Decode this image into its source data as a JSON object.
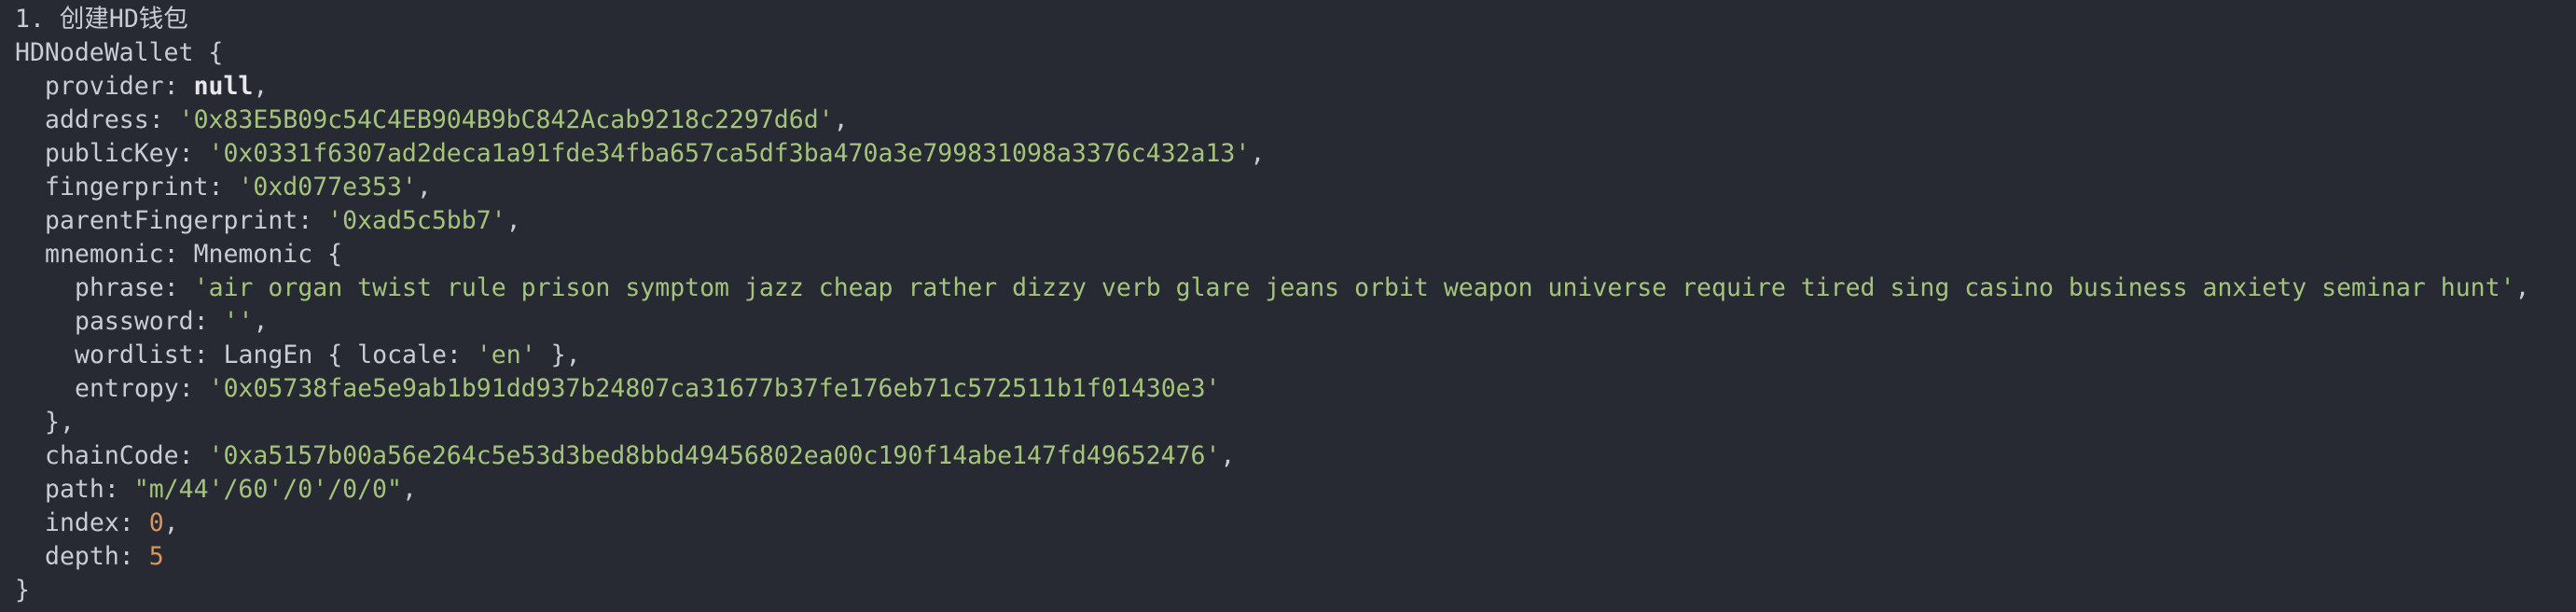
{
  "heading": "1. 创建HD钱包",
  "root_class": "HDNodeWallet",
  "fields": {
    "provider": {
      "key": "provider",
      "value": "null"
    },
    "address": {
      "key": "address",
      "value": "'0x83E5B09c54C4EB904B9bC842Acab9218c2297d6d'"
    },
    "publicKey": {
      "key": "publicKey",
      "value": "'0x0331f6307ad2deca1a91fde34fba657ca5df3ba470a3e799831098a3376c432a13'"
    },
    "fingerprint": {
      "key": "fingerprint",
      "value": "'0xd077e353'"
    },
    "parentFingerprint": {
      "key": "parentFingerprint",
      "value": "'0xad5c5bb7'"
    },
    "mnemonic": {
      "key": "mnemonic",
      "class": "Mnemonic",
      "phrase": {
        "key": "phrase",
        "value": "'air organ twist rule prison symptom jazz cheap rather dizzy verb glare jeans orbit weapon universe require tired sing casino business anxiety seminar hunt'"
      },
      "password": {
        "key": "password",
        "value": "''"
      },
      "wordlist": {
        "key": "wordlist",
        "class": "LangEn",
        "locale_key": "locale",
        "locale_value": "'en'"
      },
      "entropy": {
        "key": "entropy",
        "value": "'0x05738fae5e9ab1b91dd937b24807ca31677b37fe176eb71c572511b1f01430e3'"
      }
    },
    "chainCode": {
      "key": "chainCode",
      "value": "'0xa5157b00a56e264c5e53d3bed8bbd49456802ea00c190f14abe147fd49652476'"
    },
    "path": {
      "key": "path",
      "value": "\"m/44'/60'/0'/0/0\""
    },
    "index": {
      "key": "index",
      "value": "0"
    },
    "depth": {
      "key": "depth",
      "value": "5"
    }
  }
}
